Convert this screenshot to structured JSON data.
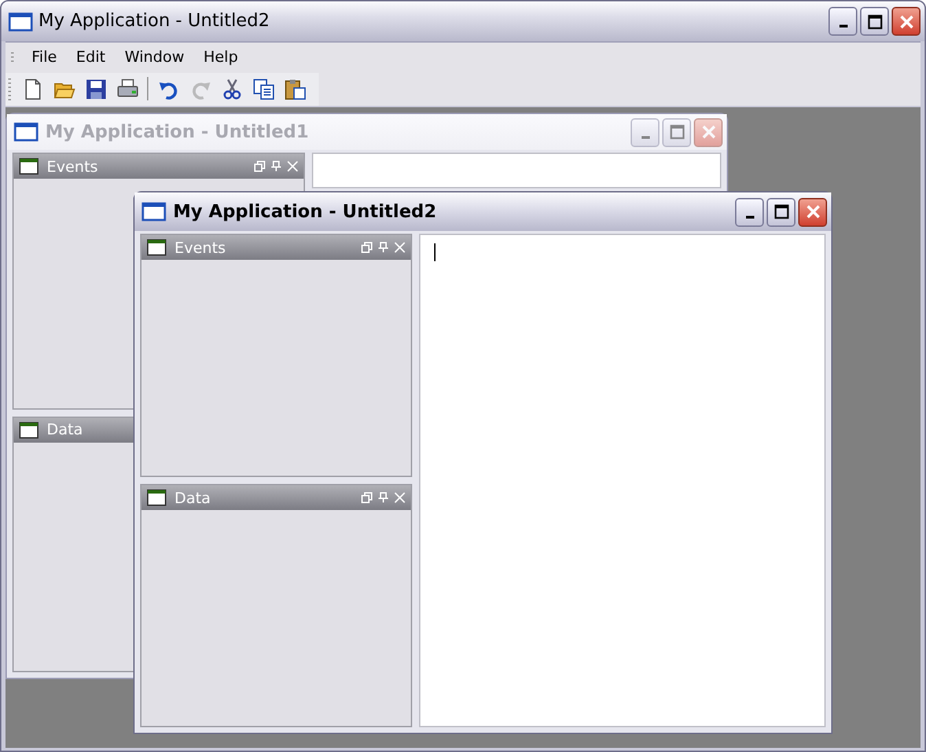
{
  "window": {
    "title": "My Application - Untitled2"
  },
  "menu": [
    "File",
    "Edit",
    "Window",
    "Help"
  ],
  "toolbar": [
    {
      "kind": "new",
      "disabled": false
    },
    {
      "kind": "open",
      "disabled": false
    },
    {
      "kind": "save",
      "disabled": false
    },
    {
      "kind": "print",
      "disabled": false
    },
    {
      "kind": "separator"
    },
    {
      "kind": "undo",
      "disabled": false
    },
    {
      "kind": "redo",
      "disabled": true
    },
    {
      "kind": "cut",
      "disabled": false
    },
    {
      "kind": "copy",
      "disabled": false
    },
    {
      "kind": "paste",
      "disabled": false
    }
  ],
  "documents": [
    {
      "title": "My Application - Untitled1",
      "active": false,
      "panels": [
        {
          "title": "Events"
        },
        {
          "title": "Data"
        }
      ]
    },
    {
      "title": "My Application - Untitled2",
      "active": true,
      "panels": [
        {
          "title": "Events"
        },
        {
          "title": "Data"
        }
      ],
      "editor": {
        "caret": true
      }
    }
  ]
}
